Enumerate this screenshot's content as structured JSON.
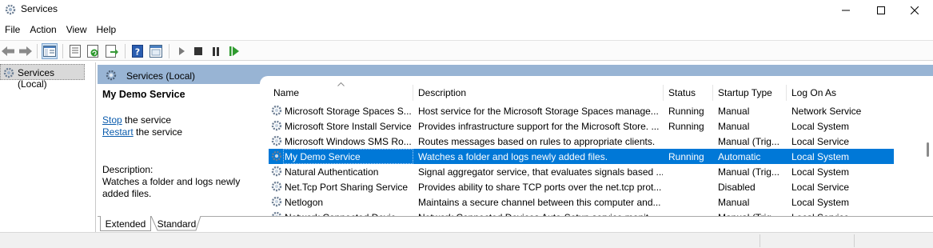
{
  "window": {
    "title": "Services"
  },
  "menu": [
    "File",
    "Action",
    "View",
    "Help"
  ],
  "toolbar": {
    "icons": [
      "back-arrow-icon",
      "forward-arrow-icon",
      "show-hide-console-tree-icon",
      "properties-icon",
      "refresh-icon",
      "export-list-icon",
      "help-icon",
      "console-icon",
      "start-service-icon",
      "stop-service-icon",
      "pause-service-icon",
      "restart-service-icon"
    ]
  },
  "tree": {
    "root_label": "Services (Local)"
  },
  "pane_header": {
    "title": "Services (Local)"
  },
  "detail": {
    "service_name": "My Demo Service",
    "stop_link": "Stop",
    "stop_rest": " the service",
    "restart_link": "Restart",
    "restart_rest": " the service",
    "description_label": "Description:",
    "description_text": "Watches a folder and logs newly added files."
  },
  "table": {
    "columns": [
      "Name",
      "Description",
      "Status",
      "Startup Type",
      "Log On As"
    ],
    "rows": [
      {
        "name": "Microsoft Storage Spaces S...",
        "description": "Host service for the Microsoft Storage Spaces manage...",
        "status": "Running",
        "startup": "Manual",
        "logon": "Network Service",
        "selected": false
      },
      {
        "name": "Microsoft Store Install Service",
        "description": "Provides infrastructure support for the Microsoft Store. ...",
        "status": "Running",
        "startup": "Manual",
        "logon": "Local System",
        "selected": false
      },
      {
        "name": "Microsoft Windows SMS Ro...",
        "description": "Routes messages based on rules to appropriate clients.",
        "status": "",
        "startup": "Manual (Trig...",
        "logon": "Local Service",
        "selected": false
      },
      {
        "name": "My Demo Service",
        "description": "Watches a folder and logs newly added files.",
        "status": "Running",
        "startup": "Automatic",
        "logon": "Local System",
        "selected": true
      },
      {
        "name": "Natural Authentication",
        "description": "Signal aggregator service, that evaluates signals based ...",
        "status": "",
        "startup": "Manual (Trig...",
        "logon": "Local System",
        "selected": false
      },
      {
        "name": "Net.Tcp Port Sharing Service",
        "description": "Provides ability to share TCP ports over the net.tcp prot...",
        "status": "",
        "startup": "Disabled",
        "logon": "Local Service",
        "selected": false
      },
      {
        "name": "Netlogon",
        "description": "Maintains a secure channel between this computer and...",
        "status": "",
        "startup": "Manual",
        "logon": "Local System",
        "selected": false
      },
      {
        "name": "Network Connected Devic...",
        "description": "Network Connected Devices Auto-Setup service monit...",
        "status": "",
        "startup": "Manual (Trig...",
        "logon": "Local Service",
        "selected": false
      }
    ]
  },
  "tabs": [
    "Extended",
    "Standard"
  ],
  "colors": {
    "selection": "#0078d7",
    "header_band": "#98b4d4",
    "link": "#0b5cad"
  }
}
